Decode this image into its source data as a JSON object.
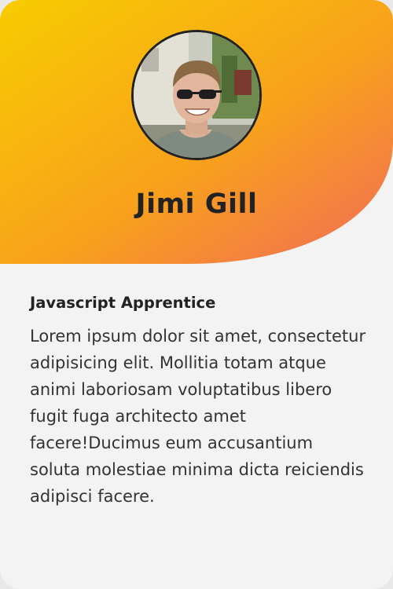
{
  "profile": {
    "name": "Jimi Gill",
    "role": "Javascript Apprentice",
    "bio": "Lorem ipsum dolor sit amet, consectetur adipisicing elit. Mollitia totam atque animi laboriosam voluptatibus libero fugit fuga architecto amet facere!Ducimus eum accusantium soluta molestiae minima dicta reiciendis adipisci facere."
  },
  "colors": {
    "gradient_start": "#f7cc00",
    "gradient_mid": "#f8a21b",
    "gradient_end": "#f26a59",
    "card_background": "#f3f3f3",
    "text": "#222222"
  },
  "icons": {
    "avatar": "avatar-photo"
  }
}
